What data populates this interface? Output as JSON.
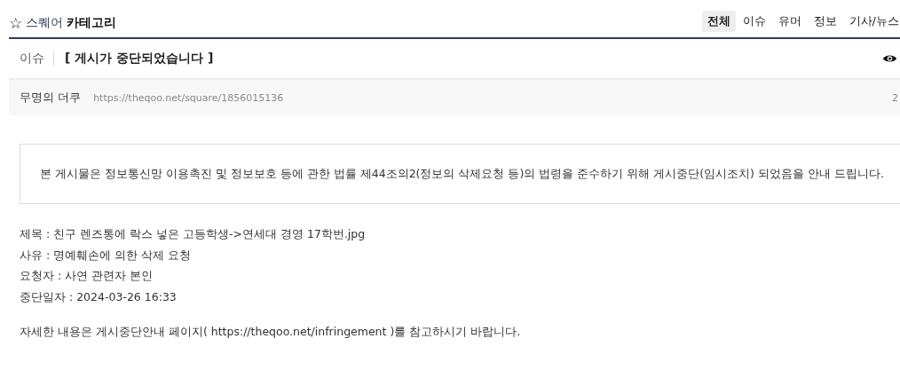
{
  "header": {
    "star": "☆",
    "category_prefix": "스퀘어",
    "category": "카테고리"
  },
  "tabs": [
    {
      "label": "전체",
      "selected": true
    },
    {
      "label": "이슈",
      "selected": false
    },
    {
      "label": "유머",
      "selected": false
    },
    {
      "label": "정보",
      "selected": false
    },
    {
      "label": "기사/뉴스",
      "selected": false
    }
  ],
  "post": {
    "category": "이슈",
    "title": "[ 게시가 중단되었습니다 ]",
    "author": "무명의 더쿠",
    "url": "https://theqoo.net/square/1856015136",
    "date": "2"
  },
  "notice": "본 게시물은 정보통신망 이용촉진 및 정보보호 등에 관한 법률 제44조의2(정보의 삭제요청 등)의 법령을 준수하기 위해 게시중단(임시조치) 되었음을 안내 드립니다.",
  "details": [
    "제목 : 친구 렌즈통에 락스 넣은 고등학생->연세대 경영 17학번.jpg",
    "사유 : 명예훼손에 의한 삭제 요청",
    "요청자 : 사연 관련자 본인",
    "중단일자 : 2024-03-26 16:33"
  ],
  "footer": "자세한 내용은 게시중단안내 페이지( https://theqoo.net/infringement )를 참고하시기 바랍니다."
}
